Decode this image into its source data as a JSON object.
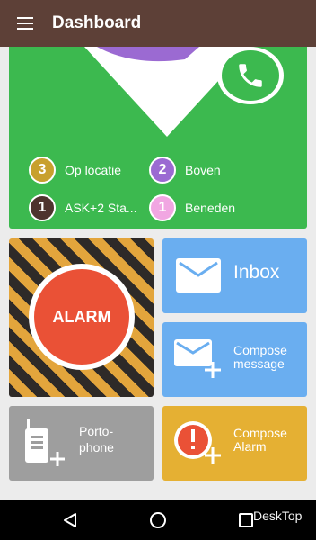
{
  "appbar": {
    "title": "Dashboard"
  },
  "legend": [
    {
      "number": "3",
      "label": "Op locatie",
      "color": "#c8a02e"
    },
    {
      "number": "2",
      "label": "Boven",
      "color": "#9b6ad2"
    },
    {
      "number": "1",
      "label": "ASK+2 Sta...",
      "color": "#4e342e"
    },
    {
      "number": "1",
      "label": "Beneden",
      "color": "#f1a6e2"
    }
  ],
  "tiles": {
    "alarm": "ALARM",
    "inbox": "Inbox",
    "compose_message": [
      "Compose",
      "message"
    ],
    "portophone": [
      "Porto-",
      "phone"
    ],
    "compose_alarm": [
      "Compose",
      "Alarm"
    ]
  },
  "watermark": "DeskTop",
  "icons": [
    "menu-icon",
    "phone-icon",
    "envelope-icon",
    "envelope-plus-icon",
    "walkie-talkie-icon",
    "alert-plus-icon",
    "back-icon",
    "home-icon",
    "recents-icon"
  ],
  "colors": {
    "appbar": "#5d4037",
    "status_card": "#3cb94f",
    "alarm": "#ea5136",
    "blue_tile": "#6aaef0",
    "grey_tile": "#9e9e9e",
    "yellow_tile": "#e5b033"
  }
}
